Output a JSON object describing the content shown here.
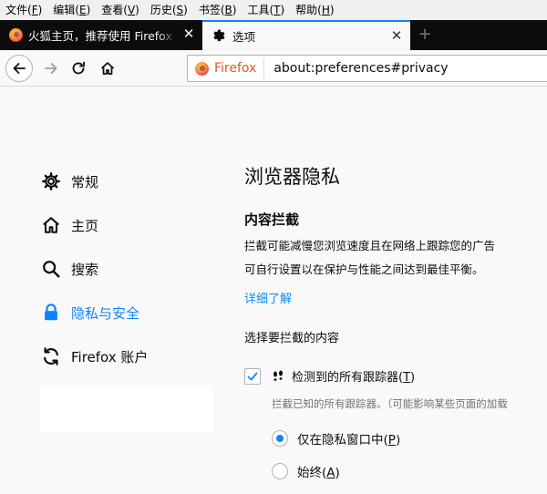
{
  "menu": [
    {
      "label": "文件(F)"
    },
    {
      "label": "编辑(E)"
    },
    {
      "label": "查看(V)"
    },
    {
      "label": "历史(S)"
    },
    {
      "label": "书签(B)"
    },
    {
      "label": "工具(T)"
    },
    {
      "label": "帮助(H)"
    }
  ],
  "tabs": [
    {
      "label": "火狐主页，推荐使用 Firefox 火",
      "icon": "firefox-logo-icon",
      "close": "✕"
    },
    {
      "label": "选项",
      "icon": "gear-icon",
      "close": "✕"
    }
  ],
  "new_tab_label": "+",
  "urlbar": {
    "identity": "Firefox",
    "url": "about:preferences#privacy"
  },
  "sidebar": [
    {
      "label": "常规",
      "icon": "gear-icon"
    },
    {
      "label": "主页",
      "icon": "home-icon"
    },
    {
      "label": "搜索",
      "icon": "search-icon"
    },
    {
      "label": "隐私与安全",
      "icon": "lock-icon",
      "selected": true
    },
    {
      "label": "Firefox 账户",
      "icon": "sync-icon"
    }
  ],
  "main": {
    "title": "浏览器隐私",
    "section_title": "内容拦截",
    "description_line1": "拦截可能减慢您浏览速度且在网络上跟踪您的广告",
    "description_line2": "可自行设置以在保护与性能之间达到最佳平衡。",
    "learn_more": "详细了解",
    "choose_label": "选择要拦截的内容",
    "trackers_checkbox": {
      "label": "检测到的所有跟踪器(T)",
      "access_key": "T",
      "checked": true,
      "description": "拦截已知的所有跟踪器。（可能影响某些页面的加载"
    },
    "radio_options": [
      {
        "label": "仅在隐私窗口中(P)",
        "selected": true
      },
      {
        "label": "始终(A)",
        "selected": false
      }
    ]
  },
  "colors": {
    "accent": "#0a84ff",
    "link": "#0a8dff",
    "tabstrip_bg": "#0c0c0d",
    "page_bg": "#f9f9fa"
  }
}
